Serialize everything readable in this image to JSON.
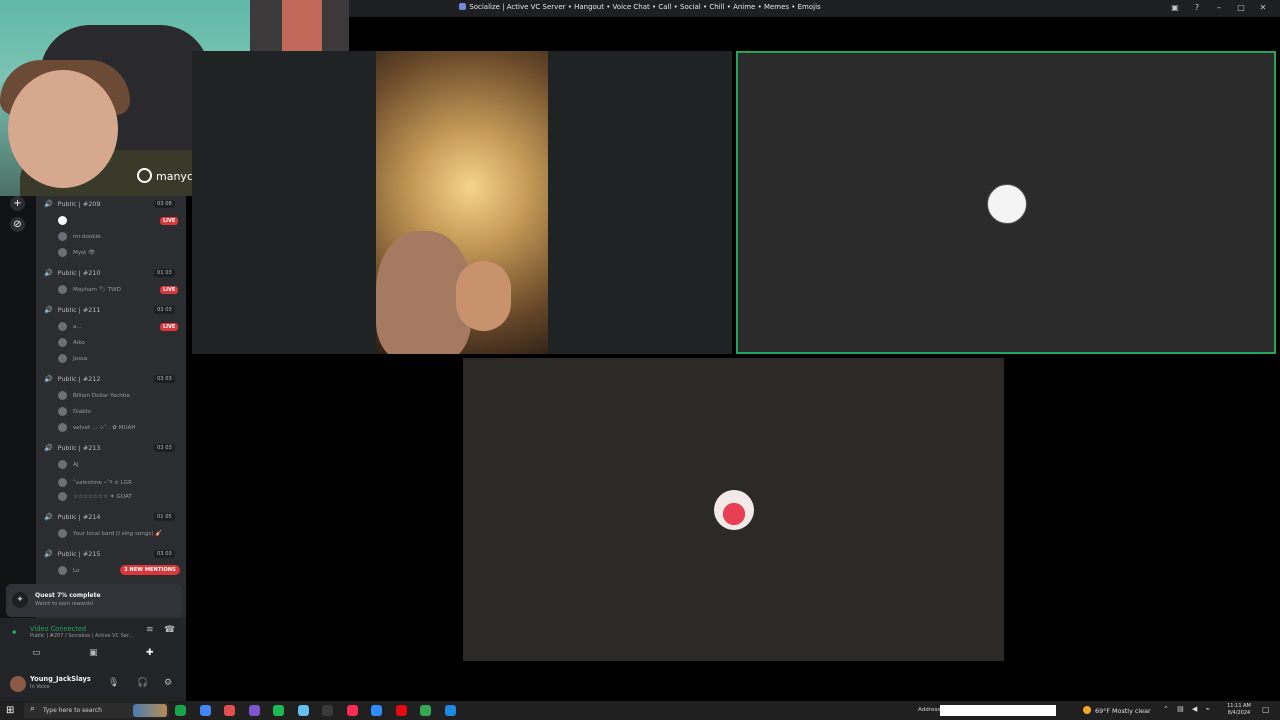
{
  "window": {
    "title": "Socialize | Active VC Server • Hangout • Voice Chat • Call • Social • Chill • Anime • Memes • Emojis",
    "controls": [
      "▣",
      "?",
      "–",
      "□",
      "✕"
    ]
  },
  "webcam": {
    "brand": "manycam"
  },
  "rail": {
    "add_icon": "+",
    "discover_icon": "⊘"
  },
  "channels": [
    {
      "name": "Public | #209",
      "count": "03 08",
      "users": [
        {
          "name": "",
          "live": true
        },
        {
          "name": "mr.dookie",
          "live": false
        },
        {
          "name": "Myst 👁",
          "live": false
        }
      ]
    },
    {
      "name": "Public | #210",
      "count": "01 03",
      "users": [
        {
          "name": "Mayham 🏷 TWD",
          "live": true
        }
      ]
    },
    {
      "name": "Public | #211",
      "count": "03 03",
      "users": [
        {
          "name": "a...",
          "live": true
        },
        {
          "name": "Aiko",
          "live": false
        },
        {
          "name": "Jossa",
          "live": false
        }
      ]
    },
    {
      "name": "Public | #212",
      "count": "03 03",
      "users": [
        {
          "name": "Billion Dollar Yachtie",
          "live": false
        },
        {
          "name": "Diablo",
          "live": false
        },
        {
          "name": "velvet ⸝⸝ ⊹˚ . ✿ MUAH",
          "live": false
        }
      ]
    },
    {
      "name": "Public | #213",
      "count": "03 03",
      "users": [
        {
          "name": "AJ",
          "live": false
        },
        {
          "name": "˚valentine ⋆˚࿔ ✮ LGR",
          "live": false
        },
        {
          "name": "☆☆☆☆☆☆☆ ✦ GOAT",
          "live": false
        }
      ]
    },
    {
      "name": "Public | #214",
      "count": "01 05",
      "users": [
        {
          "name": "Your local bard (I sing songs) 🎸",
          "live": false
        }
      ]
    },
    {
      "name": "Public | #215",
      "count": "03 03",
      "users": [
        {
          "name": "Lo",
          "live": false
        }
      ]
    }
  ],
  "mentions": "3 NEW MENTIONS",
  "quest": {
    "title": "Quest 7% complete",
    "subtitle": "Watch to earn rewards!"
  },
  "voice": {
    "status": "Video Connected",
    "channel": "Public | #207 / Socialize | Active VC Ser..."
  },
  "user": {
    "name": "Young_JackSlays",
    "status": "In Voice"
  },
  "taskbar": {
    "search_placeholder": "Type here to search",
    "address_label": "Address",
    "weather": "69°F  Mostly clear",
    "time": "11:11 AM",
    "date": "8/4/2024",
    "accent_colors": [
      "#1aa24b",
      "#4285f4",
      "#e34f4f",
      "#7a57d1",
      "#1db954",
      "#66c0f4",
      "#3a3a3a",
      "#fe2c55",
      "#2d8cff",
      "#e50914",
      "#34a853",
      "#1e88e5"
    ]
  }
}
